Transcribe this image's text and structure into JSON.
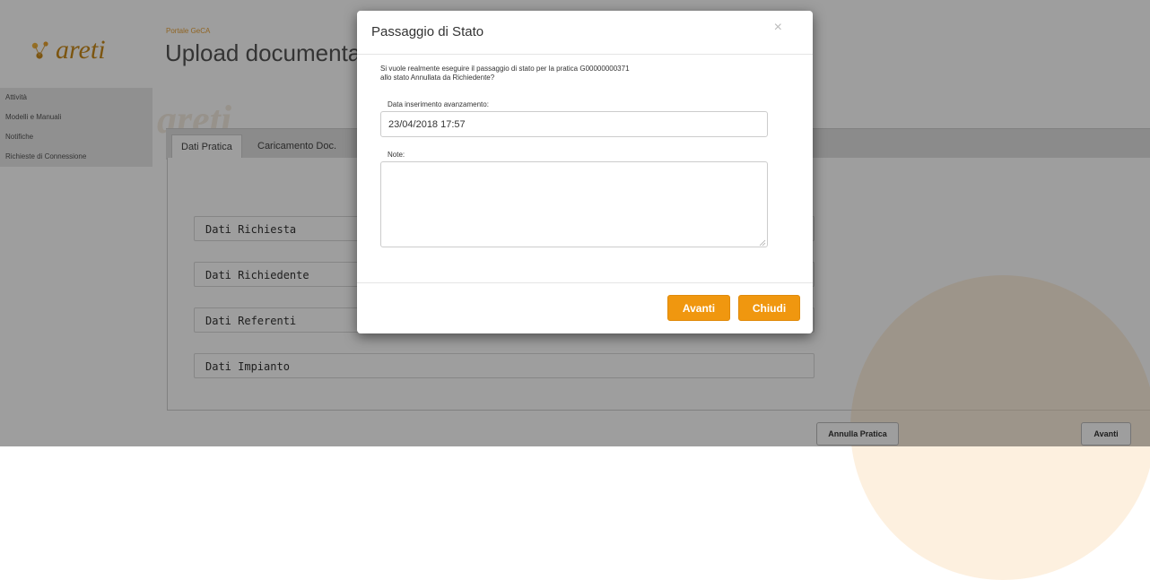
{
  "header": {
    "logo_text": "areti",
    "portal_label": "Portale GeCA",
    "page_title": "Upload documentazione"
  },
  "sidebar": {
    "items": [
      {
        "label": "Attività"
      },
      {
        "label": "Modelli e Manuali"
      },
      {
        "label": "Notifiche"
      },
      {
        "label": "Richieste di Connessione"
      }
    ]
  },
  "watermark": "areti",
  "tabs": [
    {
      "label": "Dati Pratica",
      "active": true
    },
    {
      "label": "Caricamento Doc.",
      "active": false
    }
  ],
  "sections": [
    {
      "label": "Dati Richiesta"
    },
    {
      "label": "Dati Richiedente"
    },
    {
      "label": "Dati Referenti"
    },
    {
      "label": "Dati Impianto"
    }
  ],
  "footer_buttons": {
    "annulla_pratica": "Annulla Pratica",
    "avanti": "Avanti"
  },
  "modal": {
    "title": "Passaggio di Stato",
    "close_glyph": "×",
    "message_line1": "Si vuole realmente eseguire il passaggio di stato per la pratica G00000000371",
    "message_line2": "allo stato Annullata da Richiedente?",
    "date_label": "Data inserimento avanzamento:",
    "date_value": "23/04/2018 17:57",
    "note_label": "Note:",
    "note_value": "",
    "avanti_label": "Avanti",
    "chiudi_label": "Chiudi"
  },
  "colors": {
    "accent": "#f0970f",
    "brand": "#c98a1a",
    "overlay": "rgba(0,0,0,0.38)"
  }
}
